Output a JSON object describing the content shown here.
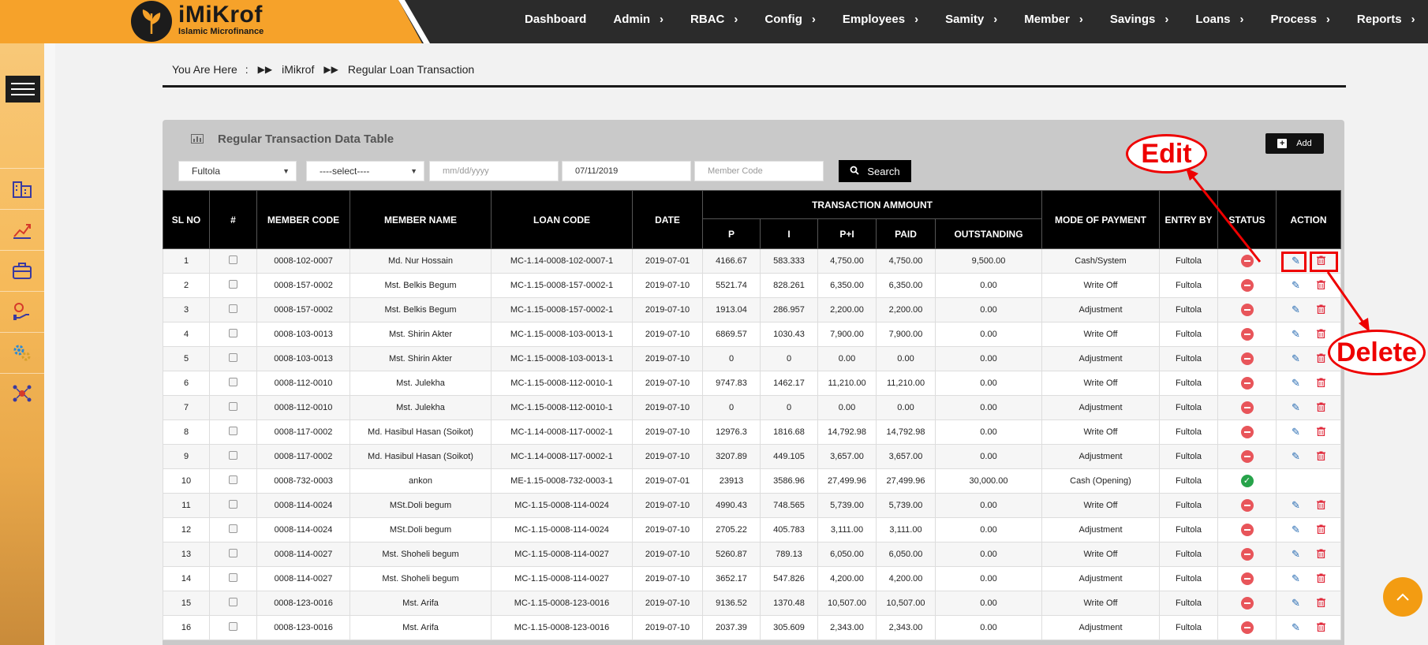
{
  "brand": {
    "title": "iMiKrof",
    "subtitle": "Islamic Microfinance"
  },
  "nav": [
    {
      "label": "Dashboard",
      "caret": false
    },
    {
      "label": "Admin",
      "caret": true
    },
    {
      "label": "RBAC",
      "caret": true
    },
    {
      "label": "Config",
      "caret": true
    },
    {
      "label": "Employees",
      "caret": true
    },
    {
      "label": "Samity",
      "caret": true
    },
    {
      "label": "Member",
      "caret": true
    },
    {
      "label": "Savings",
      "caret": true
    },
    {
      "label": "Loans",
      "caret": true
    },
    {
      "label": "Process",
      "caret": true
    },
    {
      "label": "Reports",
      "caret": true
    }
  ],
  "breadcrumb": {
    "prefix": "You Are Here",
    "colon": ":",
    "items": [
      "iMikrof",
      "Regular Loan Transaction"
    ]
  },
  "panel": {
    "title": "Regular Transaction Data Table",
    "add_label": "Add"
  },
  "filters": {
    "branch": "Fultola",
    "select": "----select----",
    "date_from_placeholder": "mm/dd/yyyy",
    "date_to": "07/11/2019",
    "member_code_placeholder": "Member Code",
    "search_label": "Search"
  },
  "table": {
    "headers": {
      "sl": "SL NO",
      "hash": "#",
      "member_code": "MEMBER CODE",
      "member_name": "MEMBER NAME",
      "loan_code": "LOAN CODE",
      "date": "DATE",
      "transaction_amount": "TRANSACTION AMMOUNT",
      "p": "P",
      "i": "I",
      "pi": "P+I",
      "paid": "PAID",
      "outstanding": "OUTSTANDING",
      "mode": "MODE OF PAYMENT",
      "entry_by": "ENTRY BY",
      "status": "STATUS",
      "action": "ACTION"
    },
    "rows": [
      {
        "sl": "1",
        "member_code": "0008-102-0007",
        "member_name": "Md. Nur Hossain",
        "loan_code": "MC-1.14-0008-102-0007-1",
        "date": "2019-07-01",
        "p": "4166.67",
        "i": "583.333",
        "pi": "4,750.00",
        "paid": "4,750.00",
        "outstanding": "9,500.00",
        "mode": "Cash/System",
        "entry_by": "Fultola",
        "status": "inactive",
        "actions": true
      },
      {
        "sl": "2",
        "member_code": "0008-157-0002",
        "member_name": "Mst. Belkis Begum",
        "loan_code": "MC-1.15-0008-157-0002-1",
        "date": "2019-07-10",
        "p": "5521.74",
        "i": "828.261",
        "pi": "6,350.00",
        "paid": "6,350.00",
        "outstanding": "0.00",
        "mode": "Write Off",
        "entry_by": "Fultola",
        "status": "inactive",
        "actions": true
      },
      {
        "sl": "3",
        "member_code": "0008-157-0002",
        "member_name": "Mst. Belkis Begum",
        "loan_code": "MC-1.15-0008-157-0002-1",
        "date": "2019-07-10",
        "p": "1913.04",
        "i": "286.957",
        "pi": "2,200.00",
        "paid": "2,200.00",
        "outstanding": "0.00",
        "mode": "Adjustment",
        "entry_by": "Fultola",
        "status": "inactive",
        "actions": true
      },
      {
        "sl": "4",
        "member_code": "0008-103-0013",
        "member_name": "Mst. Shirin Akter",
        "loan_code": "MC-1.15-0008-103-0013-1",
        "date": "2019-07-10",
        "p": "6869.57",
        "i": "1030.43",
        "pi": "7,900.00",
        "paid": "7,900.00",
        "outstanding": "0.00",
        "mode": "Write Off",
        "entry_by": "Fultola",
        "status": "inactive",
        "actions": true
      },
      {
        "sl": "5",
        "member_code": "0008-103-0013",
        "member_name": "Mst. Shirin Akter",
        "loan_code": "MC-1.15-0008-103-0013-1",
        "date": "2019-07-10",
        "p": "0",
        "i": "0",
        "pi": "0.00",
        "paid": "0.00",
        "outstanding": "0.00",
        "mode": "Adjustment",
        "entry_by": "Fultola",
        "status": "inactive",
        "actions": true
      },
      {
        "sl": "6",
        "member_code": "0008-112-0010",
        "member_name": "Mst. Julekha",
        "loan_code": "MC-1.15-0008-112-0010-1",
        "date": "2019-07-10",
        "p": "9747.83",
        "i": "1462.17",
        "pi": "11,210.00",
        "paid": "11,210.00",
        "outstanding": "0.00",
        "mode": "Write Off",
        "entry_by": "Fultola",
        "status": "inactive",
        "actions": true
      },
      {
        "sl": "7",
        "member_code": "0008-112-0010",
        "member_name": "Mst. Julekha",
        "loan_code": "MC-1.15-0008-112-0010-1",
        "date": "2019-07-10",
        "p": "0",
        "i": "0",
        "pi": "0.00",
        "paid": "0.00",
        "outstanding": "0.00",
        "mode": "Adjustment",
        "entry_by": "Fultola",
        "status": "inactive",
        "actions": true
      },
      {
        "sl": "8",
        "member_code": "0008-117-0002",
        "member_name": "Md. Hasibul Hasan (Soikot)",
        "loan_code": "MC-1.14-0008-117-0002-1",
        "date": "2019-07-10",
        "p": "12976.3",
        "i": "1816.68",
        "pi": "14,792.98",
        "paid": "14,792.98",
        "outstanding": "0.00",
        "mode": "Write Off",
        "entry_by": "Fultola",
        "status": "inactive",
        "actions": true
      },
      {
        "sl": "9",
        "member_code": "0008-117-0002",
        "member_name": "Md. Hasibul Hasan (Soikot)",
        "loan_code": "MC-1.14-0008-117-0002-1",
        "date": "2019-07-10",
        "p": "3207.89",
        "i": "449.105",
        "pi": "3,657.00",
        "paid": "3,657.00",
        "outstanding": "0.00",
        "mode": "Adjustment",
        "entry_by": "Fultola",
        "status": "inactive",
        "actions": true
      },
      {
        "sl": "10",
        "member_code": "0008-732-0003",
        "member_name": "ankon",
        "loan_code": "ME-1.15-0008-732-0003-1",
        "date": "2019-07-01",
        "p": "23913",
        "i": "3586.96",
        "pi": "27,499.96",
        "paid": "27,499.96",
        "outstanding": "30,000.00",
        "mode": "Cash (Opening)",
        "entry_by": "Fultola",
        "status": "active",
        "actions": false
      },
      {
        "sl": "11",
        "member_code": "0008-114-0024",
        "member_name": "MSt.Doli begum",
        "loan_code": "MC-1.15-0008-114-0024",
        "date": "2019-07-10",
        "p": "4990.43",
        "i": "748.565",
        "pi": "5,739.00",
        "paid": "5,739.00",
        "outstanding": "0.00",
        "mode": "Write Off",
        "entry_by": "Fultola",
        "status": "inactive",
        "actions": true
      },
      {
        "sl": "12",
        "member_code": "0008-114-0024",
        "member_name": "MSt.Doli begum",
        "loan_code": "MC-1.15-0008-114-0024",
        "date": "2019-07-10",
        "p": "2705.22",
        "i": "405.783",
        "pi": "3,111.00",
        "paid": "3,111.00",
        "outstanding": "0.00",
        "mode": "Adjustment",
        "entry_by": "Fultola",
        "status": "inactive",
        "actions": true
      },
      {
        "sl": "13",
        "member_code": "0008-114-0027",
        "member_name": "Mst. Shoheli begum",
        "loan_code": "MC-1.15-0008-114-0027",
        "date": "2019-07-10",
        "p": "5260.87",
        "i": "789.13",
        "pi": "6,050.00",
        "paid": "6,050.00",
        "outstanding": "0.00",
        "mode": "Write Off",
        "entry_by": "Fultola",
        "status": "inactive",
        "actions": true
      },
      {
        "sl": "14",
        "member_code": "0008-114-0027",
        "member_name": "Mst. Shoheli begum",
        "loan_code": "MC-1.15-0008-114-0027",
        "date": "2019-07-10",
        "p": "3652.17",
        "i": "547.826",
        "pi": "4,200.00",
        "paid": "4,200.00",
        "outstanding": "0.00",
        "mode": "Adjustment",
        "entry_by": "Fultola",
        "status": "inactive",
        "actions": true
      },
      {
        "sl": "15",
        "member_code": "0008-123-0016",
        "member_name": "Mst. Arifa",
        "loan_code": "MC-1.15-0008-123-0016",
        "date": "2019-07-10",
        "p": "9136.52",
        "i": "1370.48",
        "pi": "10,507.00",
        "paid": "10,507.00",
        "outstanding": "0.00",
        "mode": "Write Off",
        "entry_by": "Fultola",
        "status": "inactive",
        "actions": true
      },
      {
        "sl": "16",
        "member_code": "0008-123-0016",
        "member_name": "Mst. Arifa",
        "loan_code": "MC-1.15-0008-123-0016",
        "date": "2019-07-10",
        "p": "2037.39",
        "i": "305.609",
        "pi": "2,343.00",
        "paid": "2,343.00",
        "outstanding": "0.00",
        "mode": "Adjustment",
        "entry_by": "Fultola",
        "status": "inactive",
        "actions": true
      }
    ]
  },
  "annotations": {
    "edit": "Edit",
    "delete": "Delete"
  },
  "sidebar_icons": [
    "building-icon",
    "chart-growth-icon",
    "briefcase-icon",
    "hand-money-icon",
    "settings-gears-icon",
    "network-icon"
  ],
  "colors": {
    "brand_orange": "#f6a22a",
    "nav_dark": "#2b2b2b",
    "annotation_red": "#e00000",
    "scroll_button": "#f39c12"
  }
}
